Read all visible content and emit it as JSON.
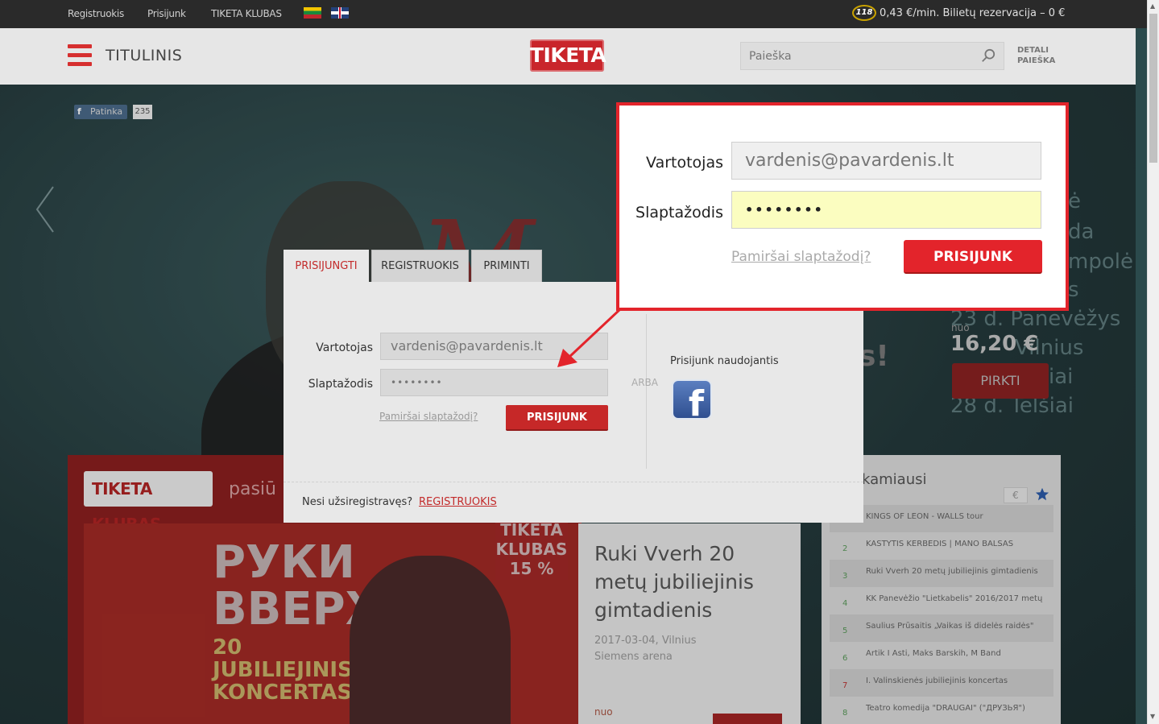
{
  "topbar": {
    "links": [
      "Registruokis",
      "Prisijunk",
      "TIKETA KLUBAS"
    ],
    "phone_badge": "118",
    "phone_text": "0,43 €/min. Bilietų rezervacija – 0 €"
  },
  "header": {
    "menu_label": "TITULINIS",
    "logo_text": "TIKETA",
    "search_placeholder": "Paieška",
    "advanced_search": [
      "DETALI",
      "PAIEŠKA"
    ]
  },
  "hero": {
    "fb_like": "Patinka",
    "fb_count": "235",
    "promo_lines": [
      "ė",
      "da",
      "mpolė",
      "s",
      "23 d. Panevėžys",
      "Vilnius",
      "iai",
      "28 d. Telšiai"
    ],
    "price_label": "nuo",
    "price": "16,20 €",
    "buy_label": "PIRKTI",
    "excl": "s!"
  },
  "klubas": {
    "logo_text": "TIKETA KLUBAS",
    "heading_partial": "pasiū",
    "poster_title": "РУКИ ВВЕРХ!",
    "poster_sub": "20 JUBILIEJINIS KONCERTAS",
    "badge": "TIKETA KLUBAS 15 %",
    "event_title": "Ruki Vverh 20 metų jubiliejinis gimtadienis",
    "event_date": "2017-03-04, Vilnius",
    "event_venue": "Siemens arena",
    "event_price_label": "nuo"
  },
  "top_sold": {
    "title": "kamiausi",
    "currency": "€",
    "items": [
      {
        "rank": "",
        "name": "KINGS OF LEON - WALLS tour"
      },
      {
        "rank": "2",
        "name": "KASTYTIS KERBEDIS | MANO BALSAS"
      },
      {
        "rank": "3",
        "name": "Ruki Vverh 20 metų jubiliejinis gimtadienis"
      },
      {
        "rank": "4",
        "name": "KK Panevėžio \"Lietkabelis\" 2016/2017 metų"
      },
      {
        "rank": "5",
        "name": "Saulius Prūsaitis „Vaikas iš didelės raidės\""
      },
      {
        "rank": "6",
        "name": "Artik I Asti, Maks Barskih, M Band"
      },
      {
        "rank": "7",
        "name": "I. Valinskienės jubiliejinis koncertas"
      },
      {
        "rank": "8",
        "name": "Teatro komedija \"DRAUGAI\" (\"ДРУЗЬЯ\")"
      }
    ]
  },
  "modal": {
    "tabs": [
      "PRISIJUNGTI",
      "REGISTRUOKIS",
      "PRIMINTI"
    ],
    "user_label": "Vartotojas",
    "user_value": "vardenis@pavardenis.lt",
    "pass_label": "Slaptažodis",
    "pass_value": "••••••••",
    "forgot": "Pamiršai slaptažodį?",
    "submit": "PRISIJUNK",
    "or": "ARBA",
    "fb_text": "Prisijunk naudojantis",
    "footer_text": "Nesi užsiregistravęs?",
    "footer_link": "REGISTRUOKIS"
  },
  "zoom": {
    "user_label": "Vartotojas",
    "user_value": "vardenis@pavardenis.lt",
    "pass_label": "Slaptažodis",
    "pass_value": "••••••••",
    "forgot": "Pamiršai slaptažodį?",
    "submit": "PRISIJUNK"
  },
  "colors": {
    "brand_red": "#c62828",
    "callout_red": "#e3242b",
    "password_highlight": "#fbfdc0"
  }
}
